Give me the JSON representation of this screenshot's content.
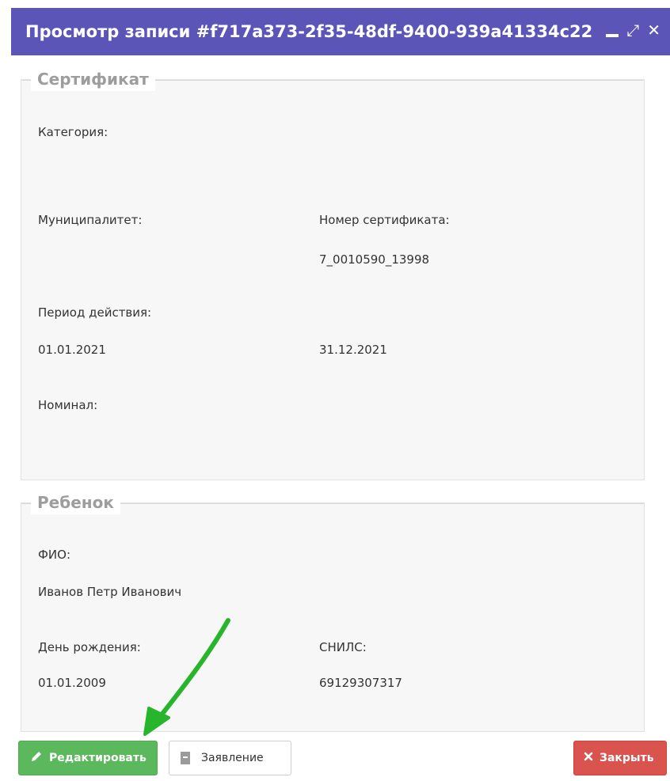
{
  "window": {
    "title": "Просмотр записи #f717a373-2f35-48df-9400-939a41334c22",
    "controls": {
      "minimize": "–",
      "maximize": "⤢",
      "close": "✕"
    }
  },
  "certificate": {
    "legend": "Сертификат",
    "category_label": "Категория:",
    "category_value": "",
    "municipality_label": "Муниципалитет:",
    "municipality_value": "",
    "number_label": "Номер сертификата:",
    "number_value": "7_0010590_13998",
    "period_label": "Период действия:",
    "period_from": "01.01.2021",
    "period_to": "31.12.2021",
    "nominal_label": "Номинал:",
    "nominal_value": ""
  },
  "child": {
    "legend": "Ребенок",
    "fio_label": "ФИО:",
    "fio_value": "Иванов Петр Иванович",
    "birthday_label": "День рождения:",
    "birthday_value": "01.01.2009",
    "snils_label": "СНИЛС:",
    "snils_value": "69129307317"
  },
  "buttons": {
    "edit": "Редактировать",
    "application": "Заявление",
    "close": "Закрыть"
  },
  "colors": {
    "titlebar": "#5a55b6",
    "edit": "#5cb85c",
    "close": "#d9534f",
    "arrow": "#27b52c"
  },
  "icons": {
    "edit": "pencil-icon",
    "application": "document-icon",
    "close": "close-icon"
  }
}
